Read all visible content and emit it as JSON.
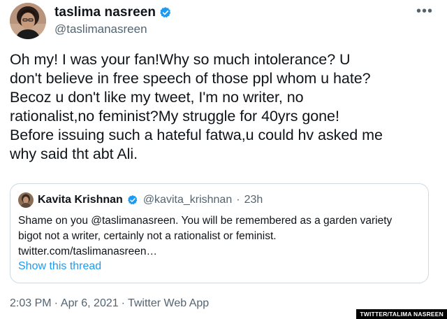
{
  "tweet": {
    "author": {
      "name": "taslima nasreen",
      "handle": "@taslimanasreen",
      "verified": true
    },
    "more_icon": "more-horizontal-icon",
    "text": "Oh my! I was your fan!Why so much intolerance? U\ndon't believe in free speech of those ppl whom u hate?\nBecoz u don't like  my tweet, I'm no writer, no\nrationalist,no feminist?My struggle for 40yrs gone!\nBefore issuing such a hateful fatwa,u could hv asked me\nwhy said tht abt Ali.",
    "quote": {
      "author_name": "Kavita Krishnan",
      "verified": true,
      "handle": "@kavita_krishnan",
      "separator": "·",
      "time": "23h",
      "text": "Shame on you @taslimanasreen. You will be remembered as a garden variety\nbigot not a writer, certainly not a rationalist or feminist.\ntwitter.com/taslimanasreen…",
      "show_thread": "Show this thread"
    },
    "meta": {
      "time": "2:03 PM",
      "separator1": "·",
      "date": "Apr 6, 2021",
      "separator2": "·",
      "source": "Twitter Web App"
    }
  },
  "credit": "TWITTER/TALIMA NASREEN",
  "colors": {
    "verified_blue": "#1d9bf0",
    "secondary_text": "#536471",
    "link_blue": "#1d9bf0",
    "border": "#cfd9de"
  }
}
